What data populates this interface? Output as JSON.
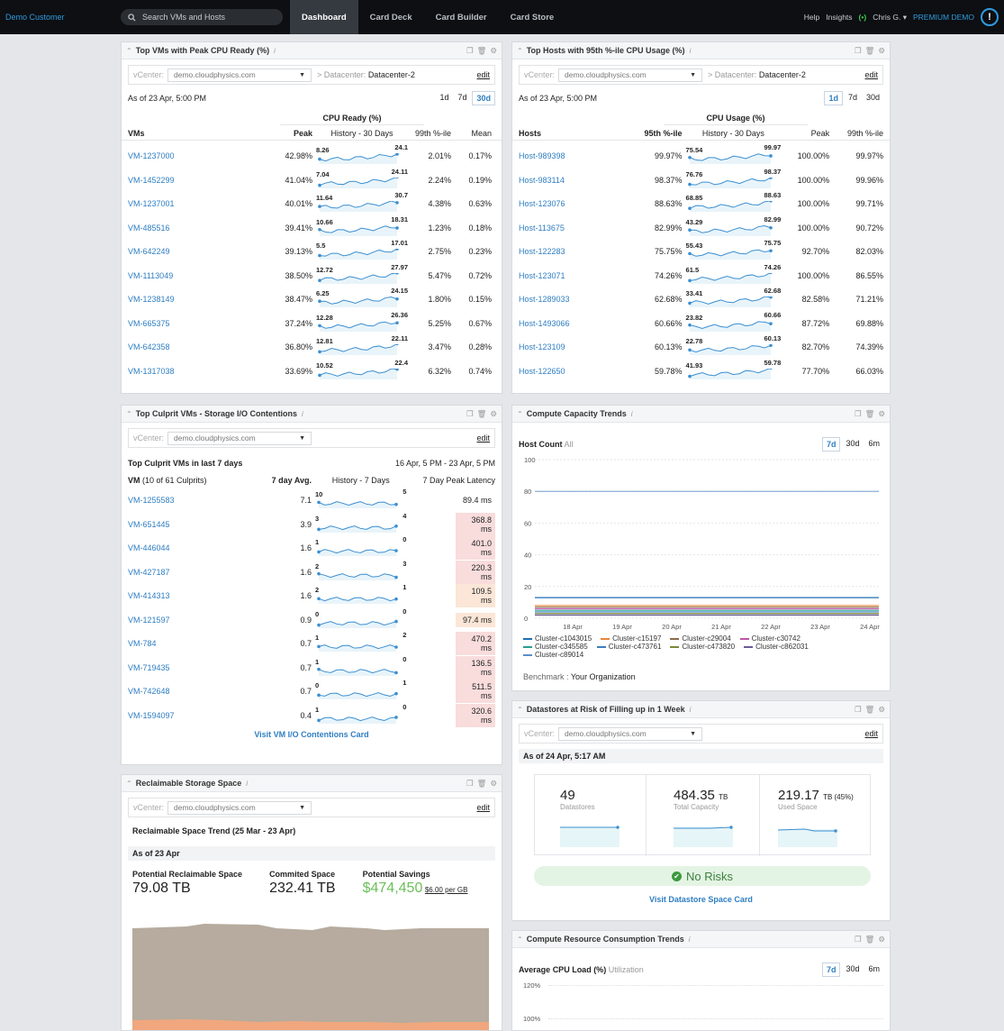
{
  "topbar": {
    "brand": "Demo Customer",
    "search_placeholder": "Search VMs and Hosts",
    "tabs": [
      "Dashboard",
      "Card Deck",
      "Card Builder",
      "Card Store"
    ],
    "help": "Help",
    "insights": "Insights",
    "user": "Chris G. ▾",
    "premium": "PREMIUM DEMO"
  },
  "vm_cpu": {
    "title": "Top VMs with Peak CPU Ready (%)",
    "vcenter_label": "vCenter:",
    "vcenter": "demo.cloudphysics.com",
    "dc_label": "> Datacenter:",
    "datacenter": "Datacenter-2",
    "edit": "edit",
    "asof": "As of 23 Apr, 5:00 PM",
    "ranges": [
      "1d",
      "7d",
      "30d"
    ],
    "group": "CPU Ready (%)",
    "cols": [
      "VMs",
      "Peak",
      "History - 30 Days",
      "99th %-ile",
      "Mean"
    ],
    "rows": [
      {
        "name": "VM-1237000",
        "peak": "42.98%",
        "lo": "8.26",
        "hi": "24.1",
        "p99": "2.01%",
        "mean": "0.17%"
      },
      {
        "name": "VM-1452299",
        "peak": "41.04%",
        "lo": "7.04",
        "hi": "24.11",
        "p99": "2.24%",
        "mean": "0.19%"
      },
      {
        "name": "VM-1237001",
        "peak": "40.01%",
        "lo": "11.64",
        "hi": "30.7",
        "p99": "4.38%",
        "mean": "0.63%"
      },
      {
        "name": "VM-485516",
        "peak": "39.41%",
        "lo": "10.66",
        "hi": "18.31",
        "p99": "1.23%",
        "mean": "0.18%"
      },
      {
        "name": "VM-642249",
        "peak": "39.13%",
        "lo": "5.5",
        "hi": "17.01",
        "p99": "2.75%",
        "mean": "0.23%"
      },
      {
        "name": "VM-1113049",
        "peak": "38.50%",
        "lo": "12.72",
        "hi": "27.97",
        "p99": "5.47%",
        "mean": "0.72%"
      },
      {
        "name": "VM-1238149",
        "peak": "38.47%",
        "lo": "6.25",
        "hi": "24.15",
        "p99": "1.80%",
        "mean": "0.15%"
      },
      {
        "name": "VM-665375",
        "peak": "37.24%",
        "lo": "12.28",
        "hi": "26.36",
        "p99": "5.25%",
        "mean": "0.67%"
      },
      {
        "name": "VM-642358",
        "peak": "36.80%",
        "lo": "12.81",
        "hi": "22.11",
        "p99": "3.47%",
        "mean": "0.28%"
      },
      {
        "name": "VM-1317038",
        "peak": "33.69%",
        "lo": "10.52",
        "hi": "22.4",
        "p99": "6.32%",
        "mean": "0.74%"
      }
    ]
  },
  "host_cpu": {
    "title": "Top Hosts with 95th %-ile CPU Usage (%)",
    "vcenter_label": "vCenter:",
    "vcenter": "demo.cloudphysics.com",
    "dc_label": "> Datacenter:",
    "datacenter": "Datacenter-2",
    "edit": "edit",
    "asof": "As of 23 Apr, 5:00 PM",
    "ranges": [
      "1d",
      "7d",
      "30d"
    ],
    "group": "CPU Usage (%)",
    "cols": [
      "Hosts",
      "95th %-ile",
      "History - 30 Days",
      "Peak",
      "99th %-ile"
    ],
    "rows": [
      {
        "name": "Host-989398",
        "p95": "99.97%",
        "lo": "75.54",
        "hi": "99.97",
        "peak": "100.00%",
        "p99": "99.97%"
      },
      {
        "name": "Host-983114",
        "p95": "98.37%",
        "lo": "76.76",
        "hi": "98.37",
        "peak": "100.00%",
        "p99": "99.96%"
      },
      {
        "name": "Host-123076",
        "p95": "88.63%",
        "lo": "68.85",
        "hi": "88.63",
        "peak": "100.00%",
        "p99": "99.71%"
      },
      {
        "name": "Host-113675",
        "p95": "82.99%",
        "lo": "43.29",
        "hi": "82.99",
        "peak": "100.00%",
        "p99": "90.72%"
      },
      {
        "name": "Host-122283",
        "p95": "75.75%",
        "lo": "55.43",
        "hi": "75.75",
        "peak": "92.70%",
        "p99": "82.03%"
      },
      {
        "name": "Host-123071",
        "p95": "74.26%",
        "lo": "61.5",
        "hi": "74.26",
        "peak": "100.00%",
        "p99": "86.55%"
      },
      {
        "name": "Host-1289033",
        "p95": "62.68%",
        "lo": "33.41",
        "hi": "62.68",
        "peak": "82.58%",
        "p99": "71.21%"
      },
      {
        "name": "Host-1493066",
        "p95": "60.66%",
        "lo": "23.82",
        "hi": "60.66",
        "peak": "87.72%",
        "p99": "69.88%"
      },
      {
        "name": "Host-123109",
        "p95": "60.13%",
        "lo": "22.78",
        "hi": "60.13",
        "peak": "82.70%",
        "p99": "74.39%"
      },
      {
        "name": "Host-122650",
        "p95": "59.78%",
        "lo": "41.93",
        "hi": "59.78",
        "peak": "77.70%",
        "p99": "66.03%"
      }
    ]
  },
  "io": {
    "title": "Top Culprit VMs - Storage I/O Contentions",
    "vcenter_label": "vCenter:",
    "vcenter": "demo.cloudphysics.com",
    "edit": "edit",
    "sub": "Top Culprit VMs in last 7 days",
    "period": "16 Apr, 5 PM - 23 Apr, 5 PM",
    "cols": [
      "VM",
      "(10 of 61 Culprits)",
      "7 day Avg.",
      "History - 7 Days",
      "7 Day Peak Latency"
    ],
    "rows": [
      {
        "name": "VM-1255583",
        "avg": "7.1",
        "a": "10",
        "b": "5",
        "lat": "89.4 ms",
        "lvl": "none"
      },
      {
        "name": "VM-651445",
        "avg": "3.9",
        "a": "3",
        "b": "4",
        "lat": "368.8 ms",
        "lvl": "red"
      },
      {
        "name": "VM-446044",
        "avg": "1.6",
        "a": "1",
        "b": "0",
        "lat": "401.0 ms",
        "lvl": "red"
      },
      {
        "name": "VM-427187",
        "avg": "1.6",
        "a": "2",
        "b": "3",
        "lat": "220.3 ms",
        "lvl": "red"
      },
      {
        "name": "VM-414313",
        "avg": "1.6",
        "a": "2",
        "b": "1",
        "lat": "109.5 ms",
        "lvl": "ora"
      },
      {
        "name": "VM-121597",
        "avg": "0.9",
        "a": "0",
        "b": "0",
        "lat": "97.4 ms",
        "lvl": "ora"
      },
      {
        "name": "VM-784",
        "avg": "0.7",
        "a": "1",
        "b": "2",
        "lat": "470.2 ms",
        "lvl": "red"
      },
      {
        "name": "VM-719435",
        "avg": "0.7",
        "a": "1",
        "b": "0",
        "lat": "136.5 ms",
        "lvl": "red"
      },
      {
        "name": "VM-742648",
        "avg": "0.7",
        "a": "0",
        "b": "1",
        "lat": "511.5 ms",
        "lvl": "red"
      },
      {
        "name": "VM-1594097",
        "avg": "0.4",
        "a": "1",
        "b": "0",
        "lat": "320.6 ms",
        "lvl": "red"
      }
    ],
    "visit": "Visit VM I/O Contentions Card"
  },
  "capacity": {
    "title": "Compute Capacity Trends",
    "label": "Host Count",
    "sub": "All",
    "ranges": [
      "7d",
      "30d",
      "6m"
    ],
    "benchmark_label": "Benchmark :",
    "benchmark": "Your Organization",
    "chart_data": {
      "type": "line",
      "x": [
        "18 Apr",
        "19 Apr",
        "20 Apr",
        "21 Apr",
        "22 Apr",
        "23 Apr",
        "24 Apr"
      ],
      "ylim": [
        0,
        100
      ],
      "yticks": [
        0,
        20,
        40,
        60,
        80,
        100
      ],
      "series": [
        {
          "name": "Cluster-c1043015",
          "color": "#1f6fb2",
          "values": [
            13,
            13,
            13,
            13,
            13,
            13,
            13
          ]
        },
        {
          "name": "Cluster-c15197",
          "color": "#e8853a",
          "values": [
            8,
            8,
            8,
            8,
            8,
            8,
            8
          ]
        },
        {
          "name": "Cluster-c29004",
          "color": "#8b6b4a",
          "values": [
            7,
            7,
            7,
            7,
            7,
            7,
            7
          ]
        },
        {
          "name": "Cluster-c30742",
          "color": "#c055a8",
          "values": [
            6,
            6,
            6,
            6,
            6,
            6,
            6
          ]
        },
        {
          "name": "Cluster-c345585",
          "color": "#2a9d8f",
          "values": [
            5,
            5,
            5,
            5,
            5,
            5,
            5
          ]
        },
        {
          "name": "Cluster-c473761",
          "color": "#3a7fc2",
          "values": [
            4,
            4,
            4,
            4,
            4,
            4,
            4
          ]
        },
        {
          "name": "Cluster-c473820",
          "color": "#7a8a3a",
          "values": [
            3,
            3,
            3,
            3,
            3,
            3,
            3
          ]
        },
        {
          "name": "Cluster-c862031",
          "color": "#6b5b95",
          "values": [
            2,
            2,
            2,
            2,
            2,
            2,
            2
          ]
        },
        {
          "name": "Cluster-c89014",
          "color": "#5b8fc7",
          "values": [
            80,
            80,
            80,
            80,
            80,
            80,
            80
          ]
        }
      ]
    }
  },
  "datastore": {
    "title": "Datastores at Risk of Filling up in 1 Week",
    "vcenter_label": "vCenter:",
    "vcenter": "demo.cloudphysics.com",
    "edit": "edit",
    "asof": "As of 24 Apr, 5:17 AM",
    "stats": [
      {
        "value": "49",
        "unit": "",
        "label": "Datastores"
      },
      {
        "value": "484.35",
        "unit": "TB",
        "label": "Total Capacity"
      },
      {
        "value": "219.17",
        "unit": "TB (45%)",
        "label": "Used Space"
      }
    ],
    "no_risk": "No Risks",
    "visit": "Visit Datastore Space Card"
  },
  "reclaim": {
    "title": "Reclaimable Storage Space",
    "vcenter_label": "vCenter:",
    "vcenter": "demo.cloudphysics.com",
    "edit": "edit",
    "trend": "Reclaimable Space Trend (25 Mar - 23 Apr)",
    "asof": "As of 23 Apr",
    "metrics": [
      {
        "label": "Potential Reclaimable Space",
        "value": "79.08 TB"
      },
      {
        "label": "Commited Space",
        "value": "232.41 TB"
      },
      {
        "label": "Potential Savings",
        "value": "$474,450",
        "extra": "$6.00 per GB"
      }
    ]
  },
  "consumption": {
    "title": "Compute Resource Consumption Trends",
    "label": "Average CPU Load (%)",
    "sub": "Utilization",
    "ranges": [
      "7d",
      "30d",
      "6m"
    ],
    "yticks": [
      "120%",
      "100%"
    ]
  }
}
